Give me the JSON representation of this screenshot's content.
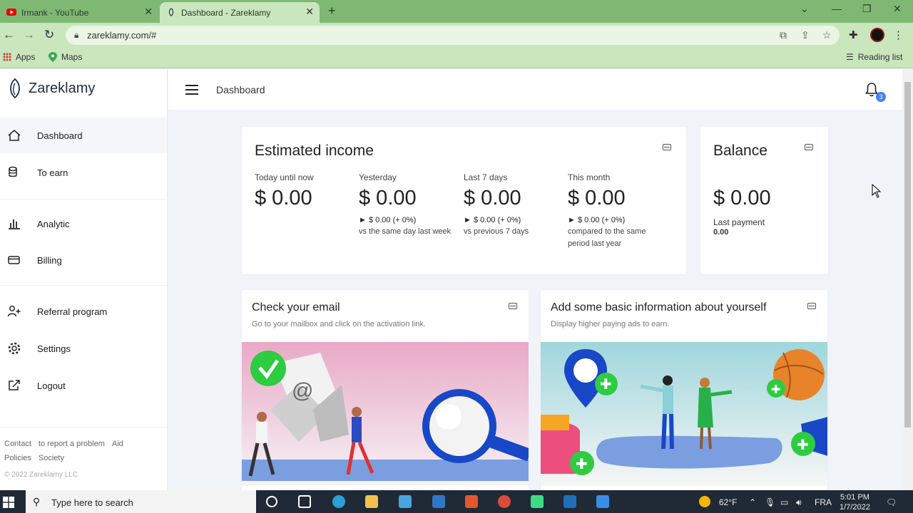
{
  "browser": {
    "tabs": [
      {
        "title": "Irmank - YouTube",
        "active": false
      },
      {
        "title": "Dashboard - Zareklamy",
        "active": true
      }
    ],
    "url": "zareklamy.com/#",
    "bookmarks": [
      {
        "label": "Apps",
        "icon": "apps-grid-icon"
      },
      {
        "label": "Maps",
        "icon": "maps-icon"
      }
    ],
    "reading_list": "Reading list"
  },
  "app": {
    "brand": "Zareklamy",
    "page_title": "Dashboard",
    "notifications_count": "3"
  },
  "sidebar": {
    "items": [
      {
        "label": "Dashboard",
        "icon": "home-icon"
      },
      {
        "label": "To earn",
        "icon": "coins-icon"
      },
      {
        "label": "Analytic",
        "icon": "bar-chart-icon"
      },
      {
        "label": "Billing",
        "icon": "card-icon"
      },
      {
        "label": "Referral program",
        "icon": "add-user-icon"
      },
      {
        "label": "Settings",
        "icon": "gear-icon"
      },
      {
        "label": "Logout",
        "icon": "logout-icon"
      }
    ],
    "footer_links": [
      "Contact",
      "to report a problem",
      "Aid",
      "Policies",
      "Society"
    ],
    "copyright": "© 2022 Zareklamy LLC"
  },
  "income": {
    "title": "Estimated income",
    "stats": [
      {
        "label": "Today until now",
        "value": "$ 0.00",
        "change": "",
        "compare": ""
      },
      {
        "label": "Yesterday",
        "value": "$ 0.00",
        "change": "► $ 0.00 (+ 0%)",
        "compare": "vs the same day last week"
      },
      {
        "label": "Last 7 days",
        "value": "$ 0.00",
        "change": "► $ 0.00 (+ 0%)",
        "compare": "vs previous 7 days"
      },
      {
        "label": "This month",
        "value": "$ 0.00",
        "change": "► $ 0.00 (+ 0%)",
        "compare": "compared to the same period last year"
      }
    ]
  },
  "balance": {
    "title": "Balance",
    "value": "$ 0.00",
    "last_payment_label": "Last payment",
    "last_payment_value": "0.00"
  },
  "tasks": [
    {
      "title": "Check your email",
      "subtitle": "Go to your mailbox and click on the activation link."
    },
    {
      "title": "Add some basic information about yourself",
      "subtitle": "Display higher paying ads to earn."
    }
  ],
  "taskbar": {
    "search_placeholder": "Type here to search",
    "weather": "62°F",
    "language": "FRA",
    "time": "5:01 PM",
    "date": "1/7/2022"
  },
  "colors": {
    "browser_frame": "#7fb873",
    "accent_blue": "#3b82f6",
    "check_green": "#2ecc40"
  }
}
